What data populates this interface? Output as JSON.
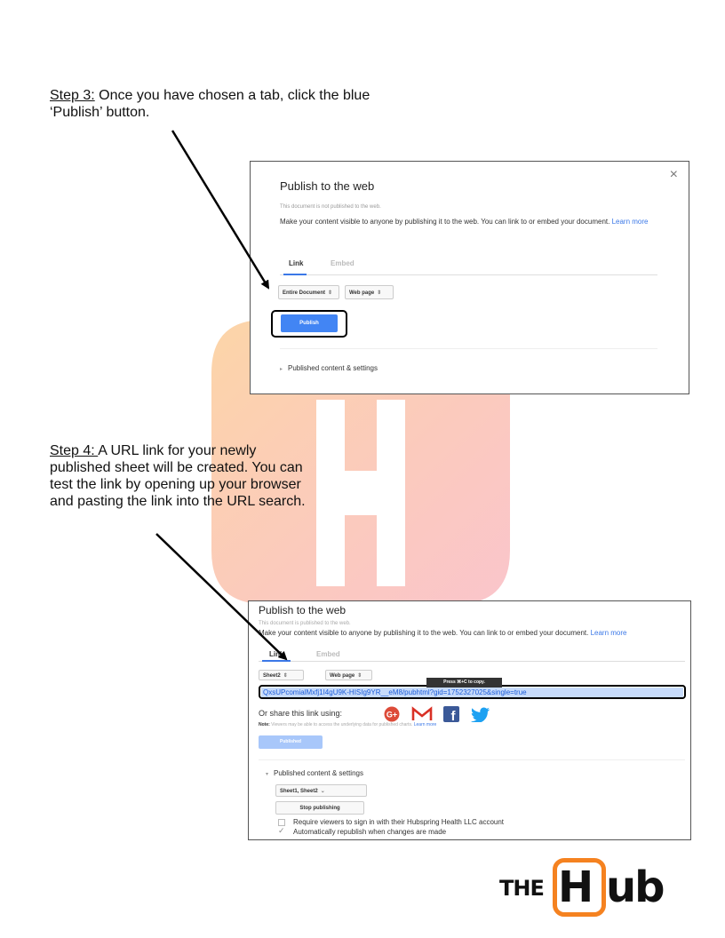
{
  "step3": {
    "label": "Step 3:",
    "text": " Once you have chosen a tab, click the blue ‘Publish’ button."
  },
  "step4": {
    "label": "Step 4: ",
    "text": "A URL link for your newly published sheet will be created. You can test the link by opening up your browser and pasting the link into the URL search."
  },
  "dialog1": {
    "close": "×",
    "title": "Publish to the web",
    "status": "This document is not published to the web.",
    "description": "Make your content visible to anyone by publishing it to the web. You can link to or embed your document.",
    "learn_more": "Learn more",
    "tab_link": "Link",
    "tab_embed": "Embed",
    "select_scope": "Entire Document",
    "select_format": "Web page",
    "publish_button": "Publish",
    "published_settings": "Published content & settings"
  },
  "dialog2": {
    "title": "Publish to the web",
    "status": "This document is published to the web.",
    "description": "Make your content visible to anyone by publishing it to the web. You can link to or embed your document.",
    "learn_more": "Learn more",
    "tab_link": "Link",
    "tab_embed": "Embed",
    "select_scope": "Sheet2",
    "select_format": "Web page",
    "tooltip": "Press ⌘+C to copy.",
    "url": "QxsUPcomialMxfj1I4gU9K-HISIg9YR__eM8/pubhtml?gid=1752327025&single=true",
    "share_label": "Or share this link using:",
    "note_label": "Note:",
    "note_text": " Viewers may be able to access the underlying data for published charts.",
    "note_learn_more": "Learn more",
    "published_button": "Published",
    "published_settings": "Published content & settings",
    "select_sheets": "Sheet1, Sheet2",
    "stop_button": "Stop publishing",
    "checkbox1": "Require viewers to sign in with their Hubspring Health LLC account",
    "checkbox2": "Automatically republish when changes are made"
  },
  "logo": {
    "the": "THE",
    "h": "H",
    "ub": "ub"
  },
  "colors": {
    "accent_blue": "#4285f4",
    "brand_orange": "#f58220",
    "link_blue": "#3b78e7"
  },
  "icons": [
    "google-plus-icon",
    "gmail-icon",
    "facebook-icon",
    "twitter-icon"
  ]
}
